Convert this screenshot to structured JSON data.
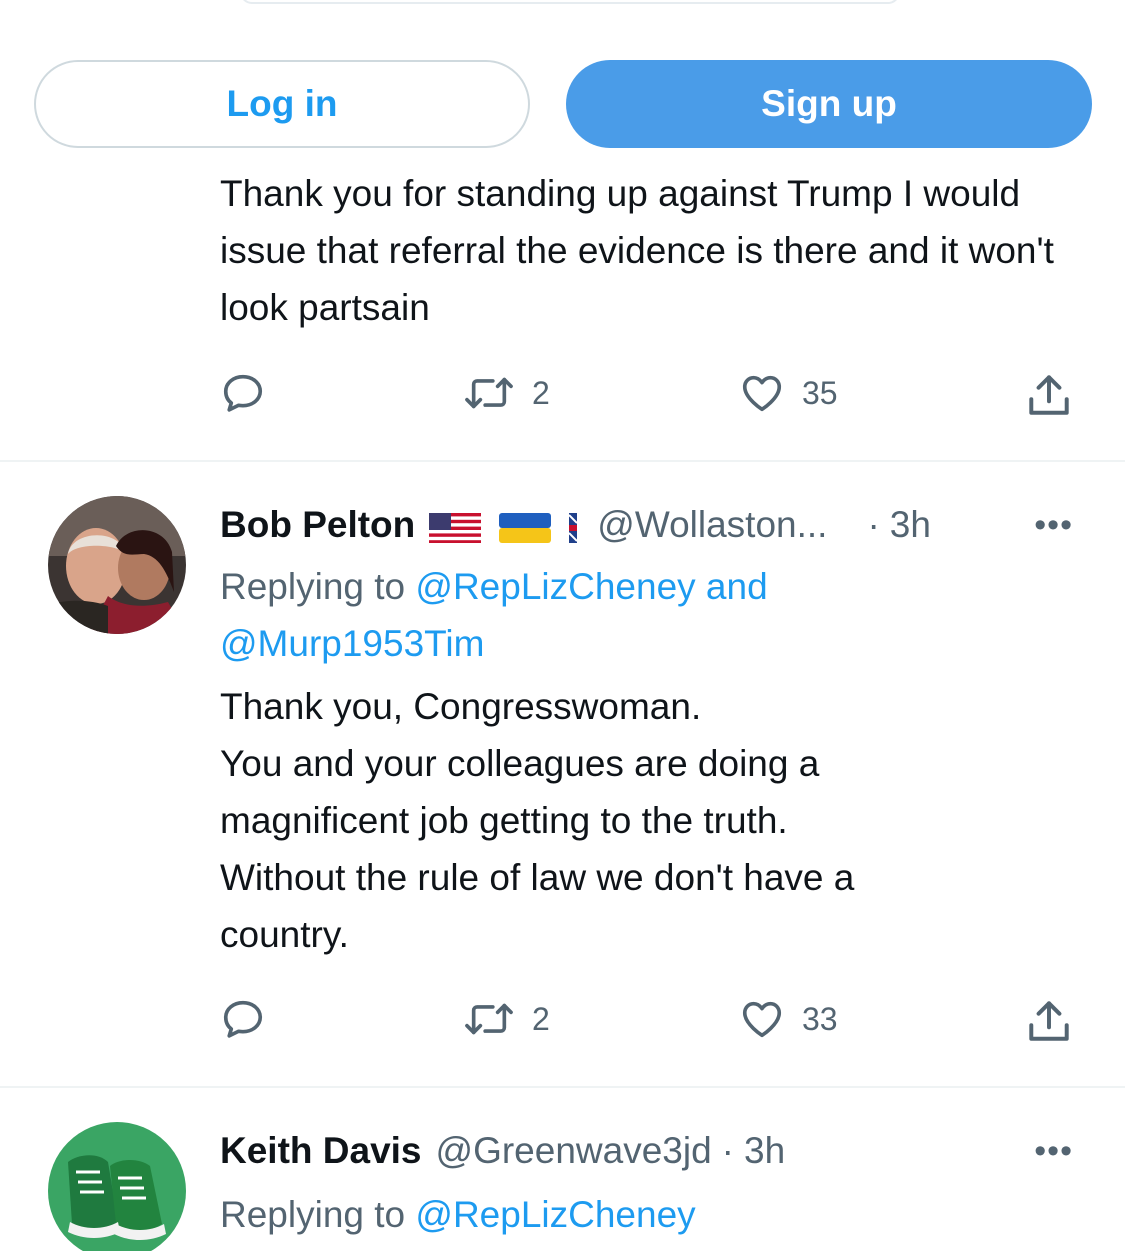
{
  "auth": {
    "login_label": "Log in",
    "signup_label": "Sign up"
  },
  "tweets": [
    {
      "text": "Thank you for standing up against Trump I would issue that referral the evidence is there and it won't look partsain",
      "replies_count": "",
      "retweets_count": "2",
      "likes_count": "35"
    },
    {
      "name": "Bob Pelton",
      "handle": "@Wollaston...",
      "time": "3h",
      "flags": [
        "us-flag",
        "ukraine-flag",
        "uk-flag"
      ],
      "replying_prefix": "Replying to",
      "replying_to": "@RepLizCheney and",
      "replying_to_2": "@Murp1953Tim",
      "lines": [
        "Thank you, Congresswoman.",
        "You and your colleagues are doing a",
        "magnificent job getting to the truth.",
        "Without the rule of law we don't have a",
        "country."
      ],
      "retweets_count": "2",
      "likes_count": "33"
    },
    {
      "name": "Keith Davis",
      "handle": "@Greenwave3jd",
      "time": "3h",
      "replying_prefix": "Replying to",
      "replying_to": "@RepLizCheney"
    }
  ],
  "separator_dot": "·",
  "more_glyph": "•••",
  "colors": {
    "accent": "#1d9bf0",
    "signup_bg": "#4a9ce8",
    "muted": "#536471",
    "divider": "#eff3f4"
  },
  "icons": [
    "reply-icon",
    "retweet-icon",
    "like-icon",
    "share-icon",
    "more-icon"
  ]
}
